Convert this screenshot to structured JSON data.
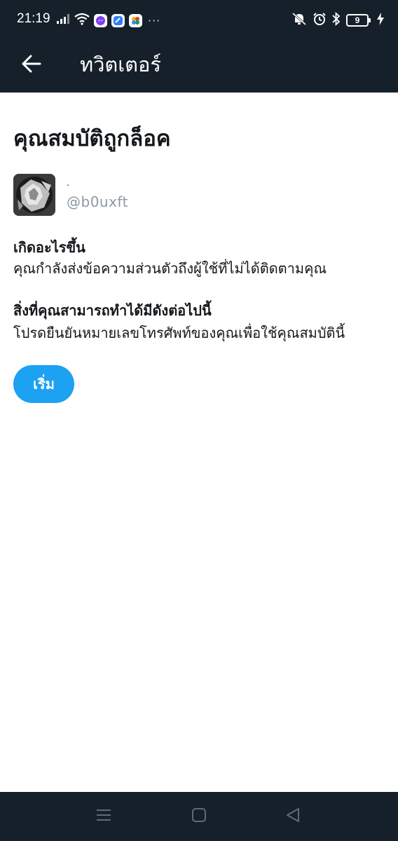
{
  "status_bar": {
    "time": "21:19",
    "battery_level": "9",
    "icons": [
      "signal-icon",
      "wifi-icon",
      "messenger-icon",
      "app-icon",
      "photos-icon",
      "more-dots-icon",
      "mute-vibrate-icon",
      "alarm-icon",
      "bluetooth-icon",
      "battery-icon",
      "charging-icon"
    ],
    "more_dots": "···"
  },
  "app_bar": {
    "title": "ทวิตเตอร์",
    "back_icon": "arrow-left-icon"
  },
  "page": {
    "title": "คุณสมบัติถูกล็อค"
  },
  "account": {
    "display_name": ".",
    "handle": "@b0uxft"
  },
  "sections": [
    {
      "heading": "เกิดอะไรขึ้น",
      "body": "คุณกำลังส่งข้อความส่วนตัวถึงผู้ใช้ที่ไม่ได้ติดตามคุณ"
    },
    {
      "heading": "สิ่งที่คุณสามารถทำได้มีดังต่อไปนี้",
      "body": "โปรดยืนยันหมายเลขโทรศัพท์ของคุณเพื่อใช้คุณสมบัตินี้"
    }
  ],
  "start_button": {
    "label": "เริ่ม"
  },
  "nav_bar": {
    "icons": [
      "menu-icon",
      "home-square-icon",
      "back-triangle-icon"
    ]
  },
  "colors": {
    "bar_background": "#15202b",
    "accent": "#1da1f2",
    "handle_text": "#8a99a6",
    "primary_text": "#14171a"
  }
}
